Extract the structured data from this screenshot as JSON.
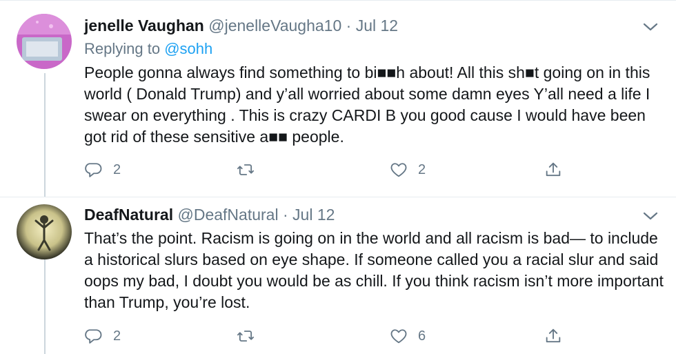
{
  "tweets": [
    {
      "display_name": "jenelle Vaughan",
      "handle": "@jenelleVaugha10",
      "separator": "·",
      "date": "Jul 12",
      "replying_to_label": "Replying to",
      "replying_to_handle": "@sohh",
      "text": "People gonna always find something to bi■■h about! All this sh■t going on in this world ( Donald Trump) and y’all worried about some damn eyes Y’all need a life I swear on everything . This is crazy CARDI B you good cause I would have been got rid of these sensitive a■■ people.",
      "reply_count": "2",
      "retweet_count": "",
      "like_count": "2",
      "avatar_colors": [
        "#d77ad0",
        "#b3c7d8"
      ]
    },
    {
      "display_name": "DeafNatural",
      "handle": "@DeafNatural",
      "separator": "·",
      "date": "Jul 12",
      "text": "That’s the point. Racism is going on in the world and all racism is bad— to include a historical slurs based on eye shape. If someone called you a racial slur and said oops my bad, I doubt you would be as chill. If you think racism isn’t more important than Trump, you’re lost.",
      "reply_count": "2",
      "retweet_count": "",
      "like_count": "6",
      "avatar_colors": [
        "#e8dfa0",
        "#4a4a3a"
      ]
    }
  ],
  "icons": {
    "reply": "reply-icon",
    "retweet": "retweet-icon",
    "like": "heart-icon",
    "share": "share-icon",
    "more": "chevron-down-icon"
  },
  "colors": {
    "link": "#1da1f2",
    "secondary": "#657786",
    "thread_line": "#ccd6dd"
  }
}
